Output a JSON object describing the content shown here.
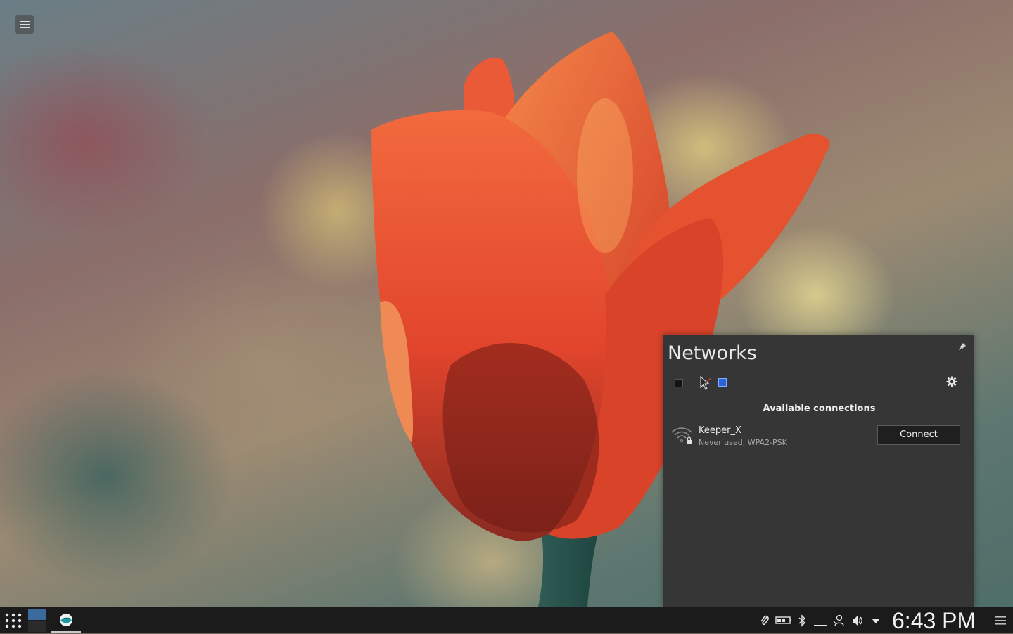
{
  "desktop": {
    "menu_icon": "hamburger-icon"
  },
  "networks": {
    "title": "Networks",
    "pin_icon": "pin-icon",
    "settings_icon": "gear-icon",
    "toolbar": {
      "wired_toggle": "checkbox-icon",
      "airplane_mode": "airplane-icon",
      "wireless_toggle": "checkbox-checked-icon"
    },
    "section_header": "Available connections",
    "connections": [
      {
        "name": "Keeper_X",
        "details": "Never used, WPA2-PSK",
        "icon": "wifi-locked-icon",
        "action": "Connect"
      }
    ]
  },
  "taskbar": {
    "launcher_icon": "app-grid-icon",
    "pager": [
      "desktop-1",
      "desktop-2"
    ],
    "task_icon": "app-icon",
    "tray_icons": [
      "paperclip-icon",
      "battery-icon",
      "bluetooth-icon",
      "display-icon",
      "user-icon",
      "volume-icon",
      "expand-arrow-icon"
    ],
    "clock": "6:43 PM",
    "panel_menu_icon": "hamburger-icon"
  },
  "colors": {
    "popup_bg": "#363636",
    "taskbar_bg": "#1b1b1b",
    "accent_blue": "#2c63d8"
  }
}
